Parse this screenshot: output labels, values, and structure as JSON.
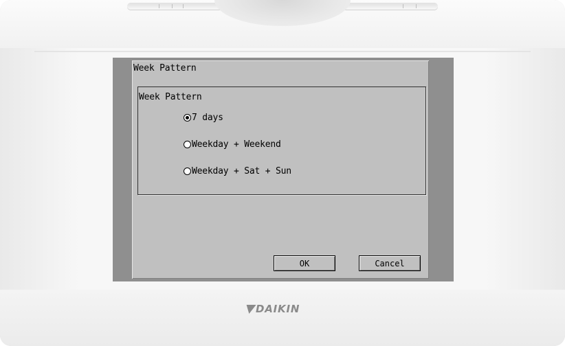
{
  "screen": {
    "title": "Week Pattern",
    "group": {
      "title": "Week Pattern",
      "options": [
        {
          "label": "7 days",
          "checked": true
        },
        {
          "label": "Weekday + Weekend",
          "checked": false
        },
        {
          "label": "Weekday + Sat + Sun",
          "checked": false
        }
      ]
    },
    "buttons": {
      "ok": "OK",
      "cancel": "Cancel"
    }
  },
  "brand": {
    "name": "DAIKIN",
    "icon": "daikin-logo-icon"
  },
  "colors": {
    "screen_bg": "#c0c0c0",
    "screen_frame": "#8f8f8f",
    "logo": "#8a8a8a"
  }
}
